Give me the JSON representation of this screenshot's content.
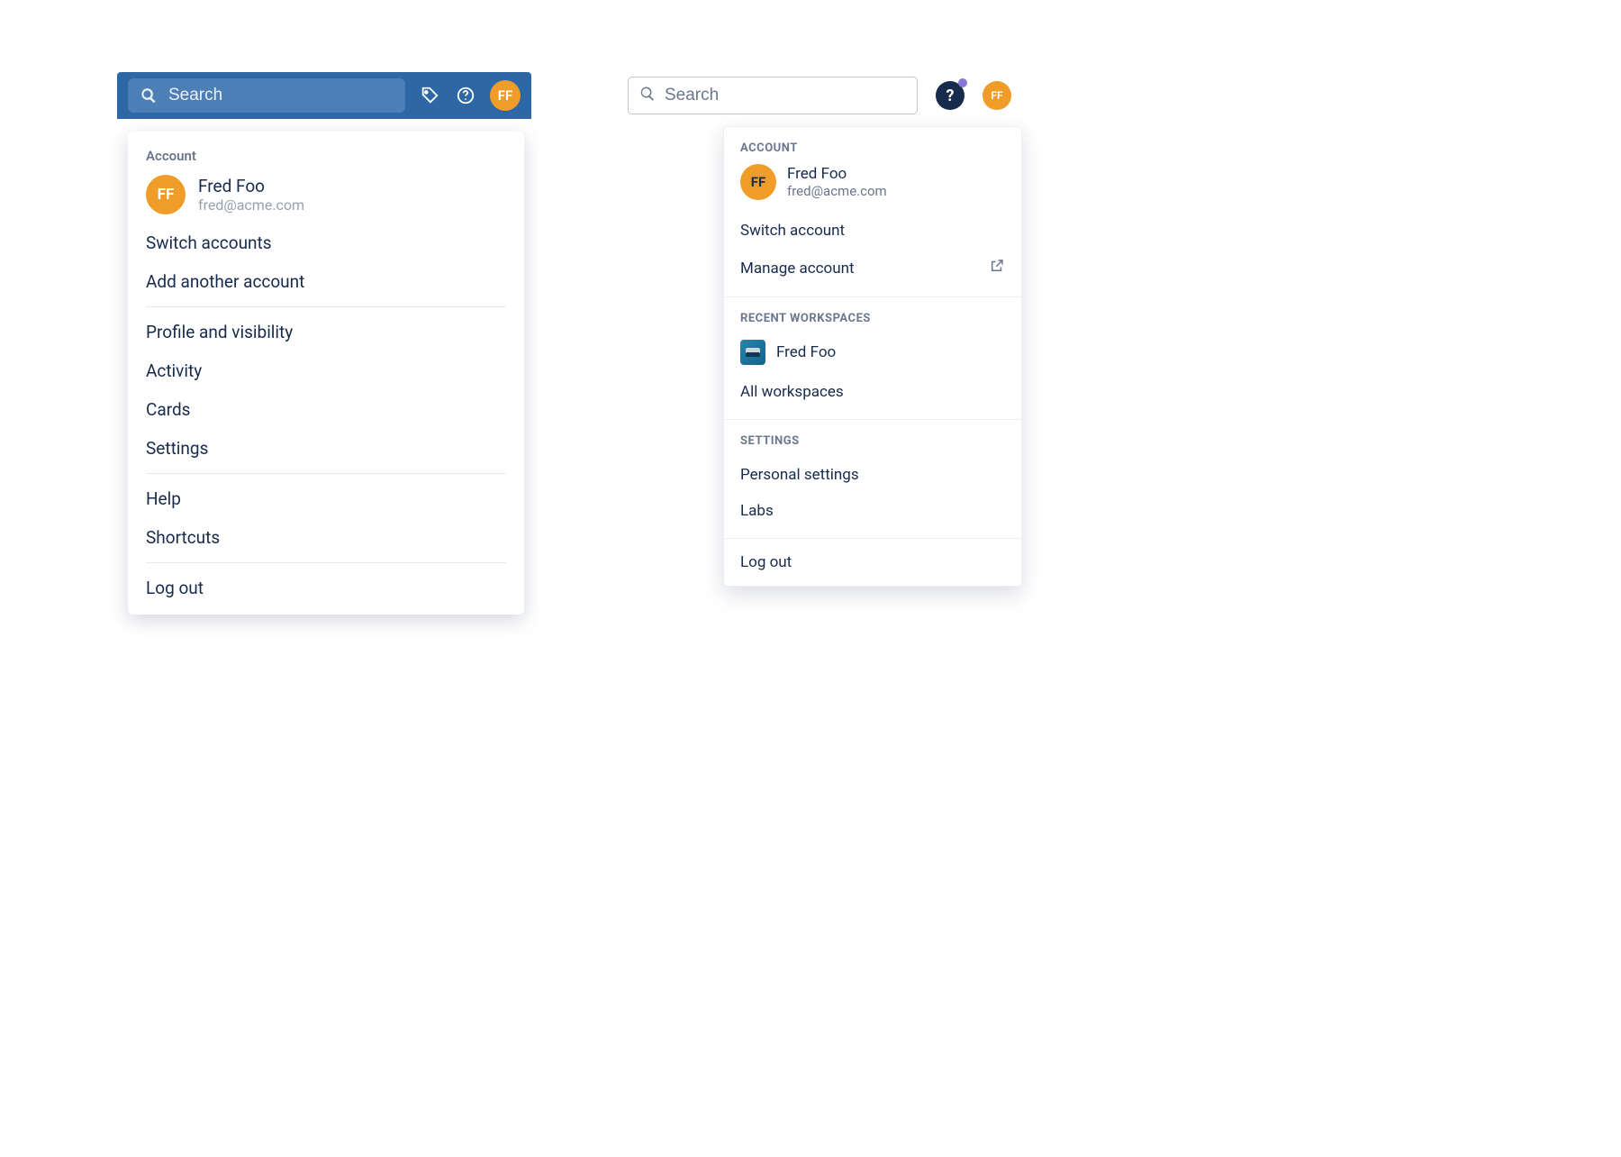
{
  "left": {
    "search_placeholder": "Search",
    "avatar_initials": "FF",
    "menu": {
      "section_title": "Account",
      "user": {
        "name": "Fred Foo",
        "email": "fred@acme.com",
        "initials": "FF"
      },
      "account_items": [
        "Switch accounts",
        "Add another account"
      ],
      "profile_items": [
        "Profile and visibility",
        "Activity",
        "Cards",
        "Settings"
      ],
      "help_items": [
        "Help",
        "Shortcuts"
      ],
      "logout": "Log out"
    }
  },
  "right": {
    "search_placeholder": "Search",
    "avatar_initials": "FF",
    "menu": {
      "account_caps": "Account",
      "user": {
        "name": "Fred Foo",
        "email": "fred@acme.com",
        "initials": "FF"
      },
      "switch": "Switch account",
      "manage": "Manage account",
      "workspaces_caps": "Recent Workspaces",
      "workspace_name": "Fred Foo",
      "all_workspaces": "All workspaces",
      "settings_caps": "Settings",
      "settings_items": [
        "Personal settings",
        "Labs"
      ],
      "logout": "Log out"
    }
  }
}
